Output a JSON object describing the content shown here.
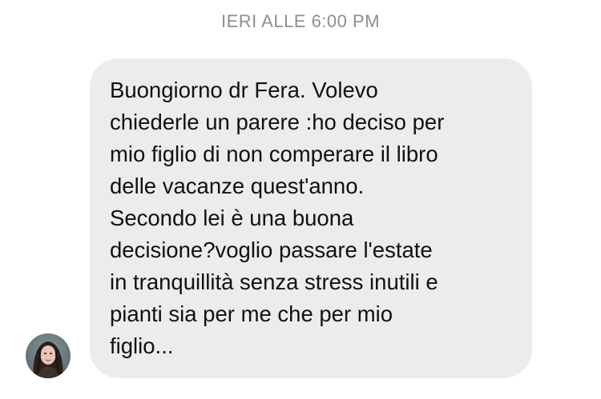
{
  "chat": {
    "timestamp": "IERI ALLE 6:00 PM",
    "message": {
      "text": "Buongiorno dr Fera. Volevo\nchiederle un parere :ho deciso per\nmio figlio di non comperare il libro\ndelle vacanze quest'anno.\nSecondo lei è una buona\ndecisione?voglio passare l'estate\nin tranquillità senza stress inutili e\npianti sia per me che per mio\nfiglio..."
    },
    "sender": {
      "avatar_icon": "profile-photo"
    },
    "colors": {
      "bubble": "#ececee",
      "timestamp": "#8e8e93",
      "text": "#111111"
    }
  }
}
